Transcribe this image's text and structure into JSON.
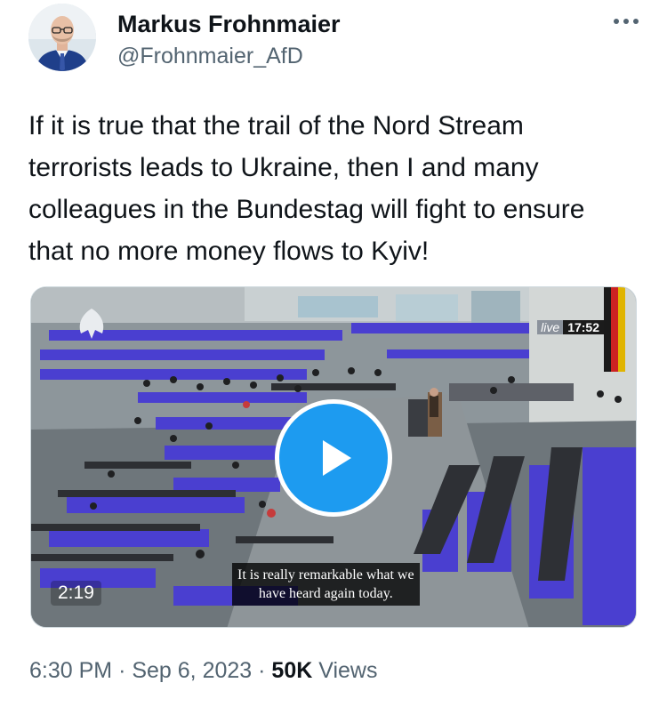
{
  "author": {
    "name": "Markus Frohnmaier",
    "handle": "@Frohnmaier_AfD",
    "avatar_icon": "profile-photo"
  },
  "tweet": {
    "text": "If it is true that the trail of the Nord Stream terrorists leads to Ukraine, then I and many colleagues in the Bundestag will fight to ensure that no more money flows to Kyiv!"
  },
  "video": {
    "duration": "2:19",
    "live_label": "live",
    "clock": "17:52",
    "subtitle_line1": "It is really remarkable what we",
    "subtitle_line2": "have heard again today."
  },
  "meta": {
    "time": "6:30 PM",
    "date": "Sep 6, 2023",
    "views_count": "50K",
    "views_label": "Views",
    "separator": "·"
  },
  "colors": {
    "accent": "#1d9bf0",
    "text_primary": "#0f1419",
    "text_secondary": "#536471",
    "seat_purple": "#4a3fd0"
  },
  "icons": {
    "more": "more-dots-icon",
    "play": "play-icon",
    "eagle": "federal-eagle-icon"
  }
}
